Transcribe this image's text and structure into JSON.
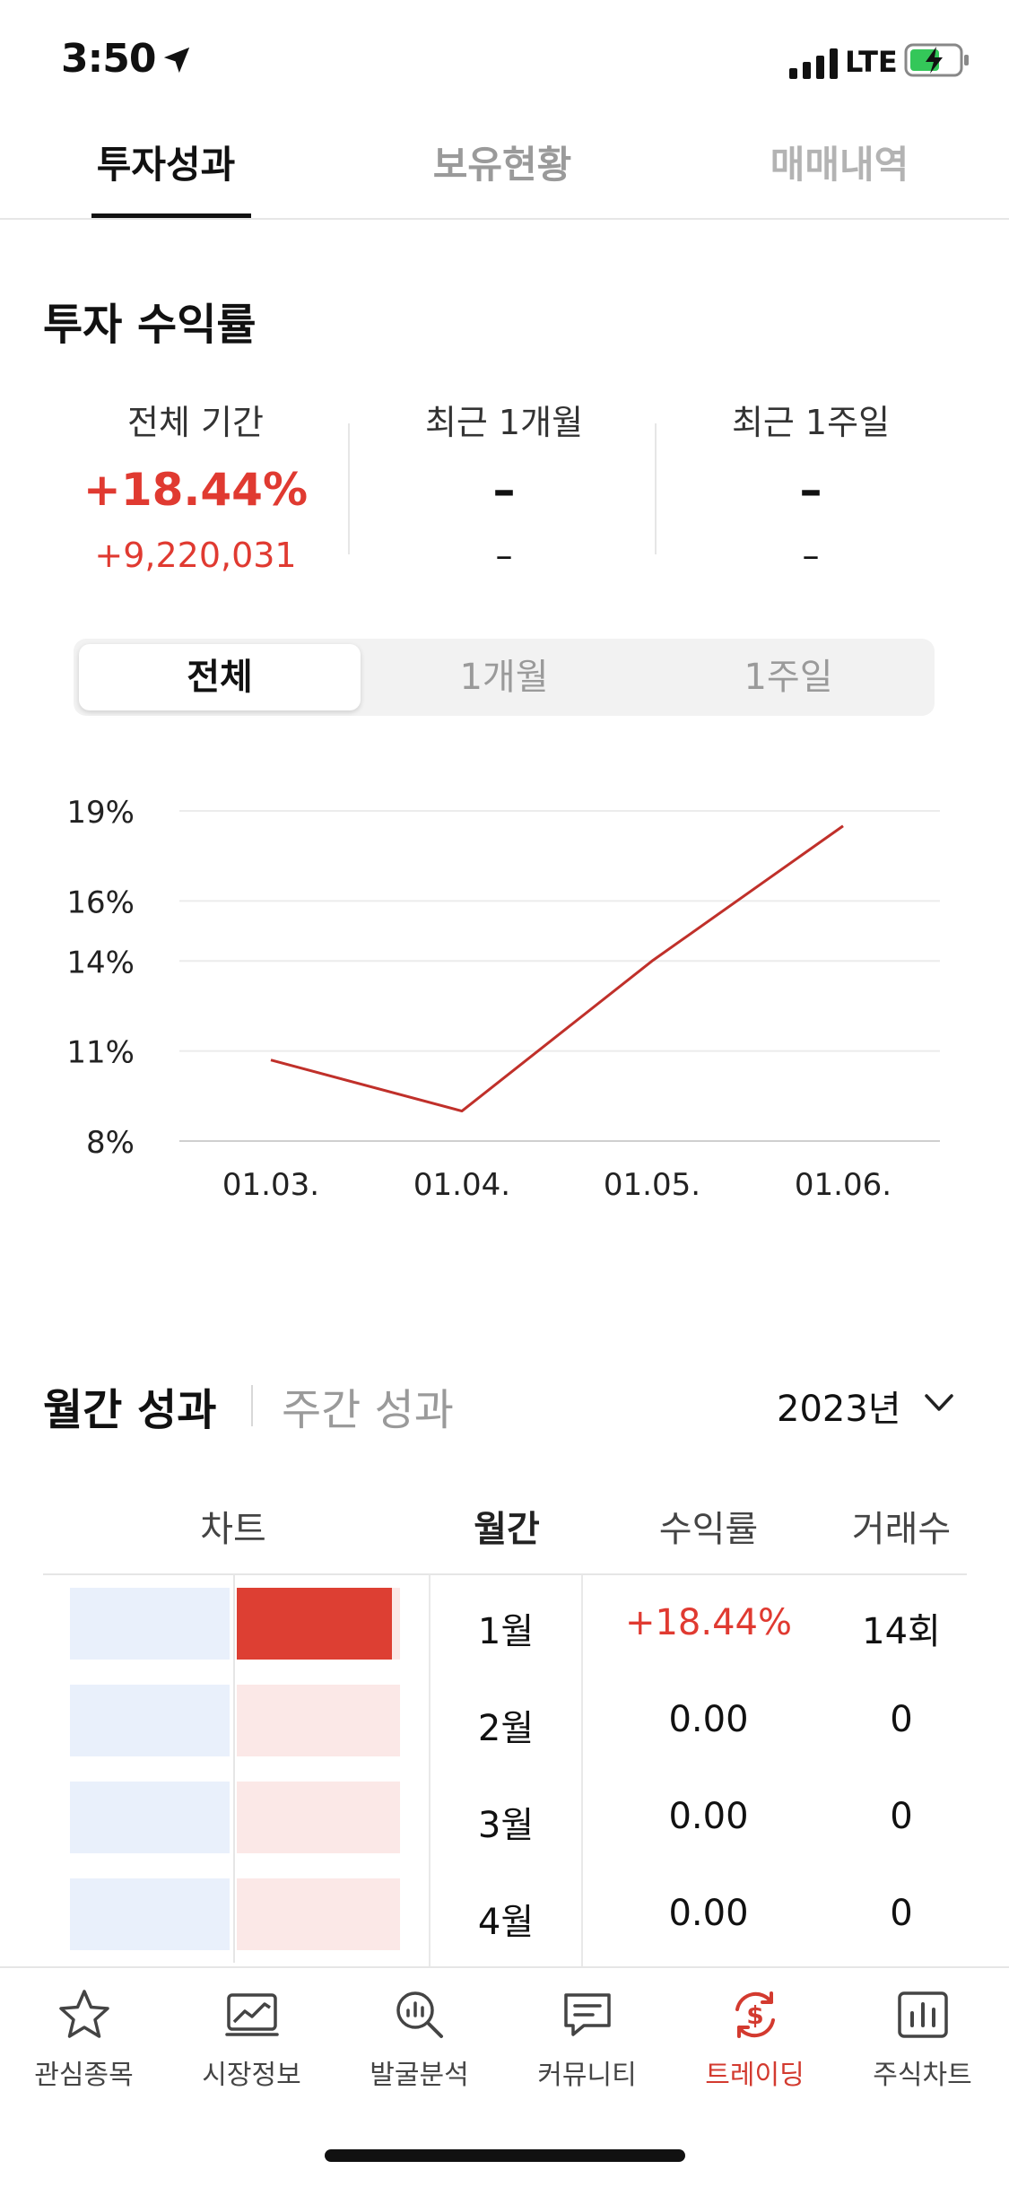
{
  "status_bar": {
    "time": "3:50",
    "network": "LTE"
  },
  "tabs": [
    {
      "label": "투자성과",
      "active": true
    },
    {
      "label": "보유현황",
      "active": false
    },
    {
      "label": "매매내역",
      "active": false
    }
  ],
  "section_title": "투자 수익률",
  "periods": [
    {
      "label": "전체 기간",
      "pct": "+18.44%",
      "amount": "+9,220,031"
    },
    {
      "label": "최근 1개월",
      "pct": "–",
      "amount": "–"
    },
    {
      "label": "최근 1주일",
      "pct": "–",
      "amount": "–"
    }
  ],
  "segment": [
    "전체",
    "1개월",
    "1주일"
  ],
  "chart_data": {
    "type": "line",
    "x": [
      "01.03.",
      "01.04.",
      "01.05.",
      "01.06."
    ],
    "series": [
      {
        "values": [
          10.7,
          9.0,
          14.0,
          18.5
        ]
      }
    ],
    "y_ticks": [
      "19%",
      "16%",
      "14%",
      "11%",
      "8%"
    ],
    "y_tick_values": [
      19,
      16,
      14,
      11,
      8
    ],
    "ylim": [
      8,
      19
    ],
    "line_color": "#c0302a",
    "grid": true
  },
  "monthly": {
    "title": "월간 성과",
    "alt_title": "주간 성과",
    "year": "2023년",
    "headers": [
      "차트",
      "월간",
      "수익률",
      "거래수"
    ],
    "rows": [
      {
        "month": "1월",
        "ret": "+18.44%",
        "count": "14회",
        "bar": 0.95,
        "positive": true
      },
      {
        "month": "2월",
        "ret": "0.00",
        "count": "0",
        "bar": 0,
        "positive": false
      },
      {
        "month": "3월",
        "ret": "0.00",
        "count": "0",
        "bar": 0,
        "positive": false
      },
      {
        "month": "4월",
        "ret": "0.00",
        "count": "0",
        "bar": 0,
        "positive": false
      }
    ]
  },
  "bottom_nav": [
    {
      "label": "관심종목",
      "icon": "star-icon",
      "active": false
    },
    {
      "label": "시장정보",
      "icon": "market-chart-icon",
      "active": false
    },
    {
      "label": "발굴분석",
      "icon": "search-analysis-icon",
      "active": false
    },
    {
      "label": "커뮤니티",
      "icon": "chat-icon",
      "active": false
    },
    {
      "label": "트레이딩",
      "icon": "trading-dollar-icon",
      "active": true
    },
    {
      "label": "주식차트",
      "icon": "bar-chart-icon",
      "active": false
    }
  ],
  "colors": {
    "accent_red": "#e03a31",
    "bar_red": "#dd3f33",
    "bar_blue_bg": "#e9f0fb",
    "bar_red_bg": "#fbe8e7"
  }
}
